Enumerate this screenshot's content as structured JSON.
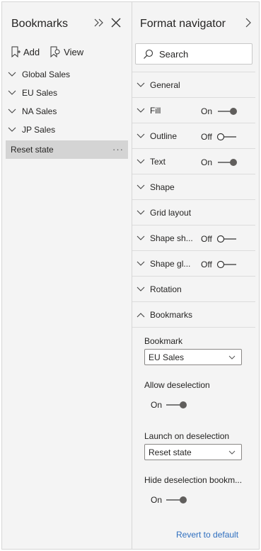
{
  "bookmarks_pane": {
    "title": "Bookmarks",
    "add_label": "Add",
    "view_label": "View",
    "items": [
      {
        "label": "Global Sales"
      },
      {
        "label": "EU Sales"
      },
      {
        "label": "NA Sales"
      },
      {
        "label": "JP Sales"
      }
    ],
    "selected_item": {
      "label": "Reset state",
      "more": "···"
    }
  },
  "format_pane": {
    "title": "Format navigator",
    "search_placeholder": "Search",
    "sections": [
      {
        "label": "General"
      },
      {
        "label": "Fill",
        "toggle": "On"
      },
      {
        "label": "Outline",
        "toggle": "Off"
      },
      {
        "label": "Text",
        "toggle": "On"
      },
      {
        "label": "Shape"
      },
      {
        "label": "Grid layout"
      },
      {
        "label": "Shape sh...",
        "toggle": "Off"
      },
      {
        "label": "Shape gl...",
        "toggle": "Off"
      },
      {
        "label": "Rotation"
      },
      {
        "label": "Bookmarks"
      }
    ],
    "bookmarks_card": {
      "bookmark_label": "Bookmark",
      "bookmark_value": "EU Sales",
      "allow_deselection_label": "Allow deselection",
      "allow_deselection_state": "On",
      "launch_label": "Launch on deselection",
      "launch_value": "Reset state",
      "hide_label": "Hide deselection bookm...",
      "hide_state": "On"
    },
    "revert_label": "Revert to default"
  },
  "colors": {
    "accent_link": "#2f6fbf",
    "toggle_on": "#605e5c",
    "panel_bg": "#f4f4f4",
    "selected_bg": "#d4d4d4"
  }
}
